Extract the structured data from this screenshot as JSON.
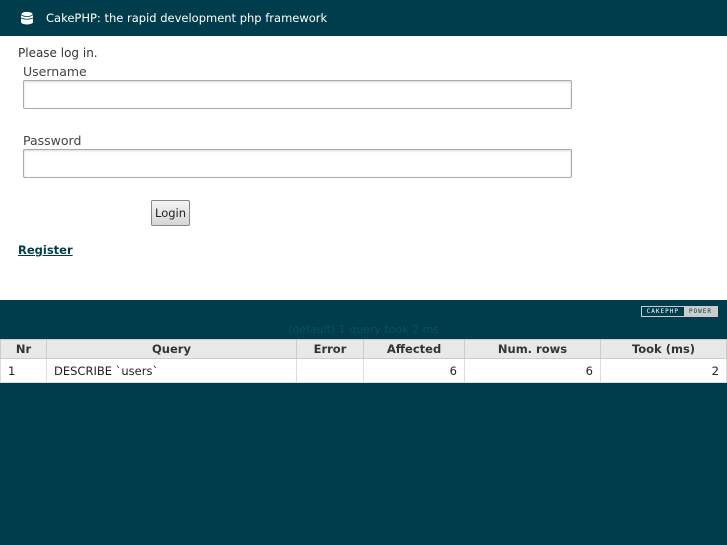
{
  "header": {
    "title": "CakePHP: the rapid development php framework",
    "logo_icon": "cake-logo-icon"
  },
  "form": {
    "flash": "Please log in.",
    "username_label": "Username",
    "username_value": "",
    "password_label": "Password",
    "password_value": "",
    "login_label": "Login"
  },
  "links": {
    "register": "Register"
  },
  "footer": {
    "powered_left": "CAKEPHP",
    "powered_right": "POWER",
    "sql_caption": "(default) 1 query took 2 ms"
  },
  "sql_log": {
    "columns": [
      "Nr",
      "Query",
      "Error",
      "Affected",
      "Num. rows",
      "Took (ms)"
    ],
    "rows": [
      {
        "nr": "1",
        "query": "DESCRIBE `users`",
        "error": "",
        "affected": "6",
        "num_rows": "6",
        "took": "2"
      }
    ]
  },
  "colors": {
    "brand": "#003d4c",
    "background": "#ffffff"
  }
}
